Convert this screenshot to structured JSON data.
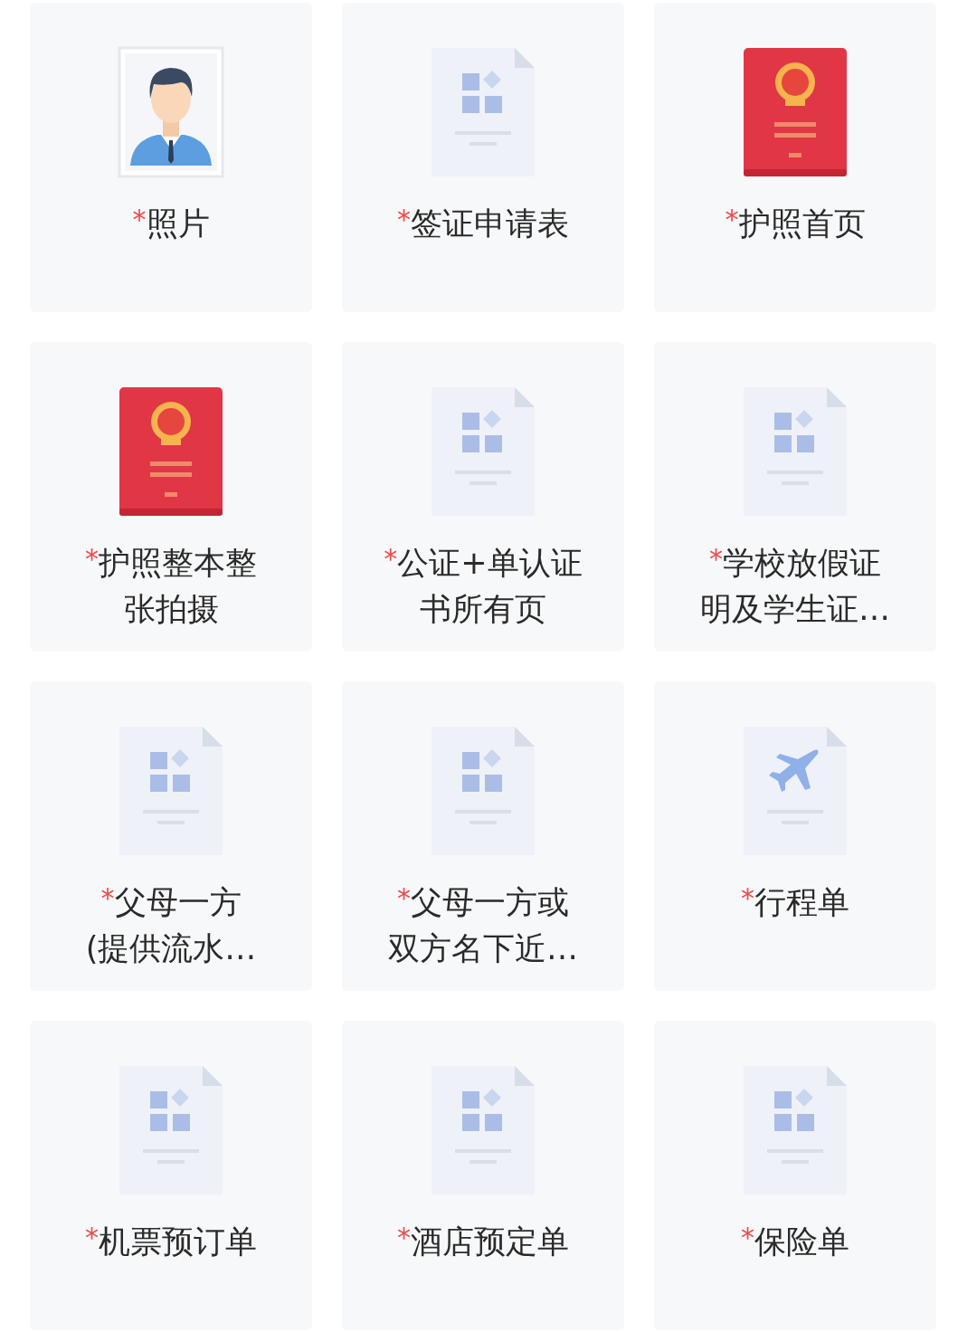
{
  "cards": [
    {
      "kind": "photo",
      "mark": "*",
      "lines": [
        "照片"
      ]
    },
    {
      "kind": "document",
      "mark": "*",
      "lines": [
        "签证申请表"
      ]
    },
    {
      "kind": "passport",
      "mark": "*",
      "lines": [
        "护照首页"
      ]
    },
    {
      "kind": "passport",
      "mark": "*",
      "lines": [
        "护照整本整",
        "张拍摄"
      ]
    },
    {
      "kind": "document",
      "mark": "*",
      "lines": [
        "公证+单认证",
        "书所有页"
      ]
    },
    {
      "kind": "document",
      "mark": "*",
      "lines": [
        "学校放假证",
        "明及学生证…"
      ]
    },
    {
      "kind": "document",
      "mark": "*",
      "lines": [
        "父母一方",
        "(提供流水…"
      ]
    },
    {
      "kind": "document",
      "mark": "*",
      "lines": [
        "父母一方或",
        "双方名下近…"
      ]
    },
    {
      "kind": "plane",
      "mark": "*",
      "lines": [
        "行程单"
      ]
    },
    {
      "kind": "document",
      "mark": "*",
      "lines": [
        "机票预订单"
      ]
    },
    {
      "kind": "document",
      "mark": "*",
      "lines": [
        "酒店预定单"
      ]
    },
    {
      "kind": "document",
      "mark": "*",
      "lines": [
        "保险单"
      ]
    }
  ]
}
